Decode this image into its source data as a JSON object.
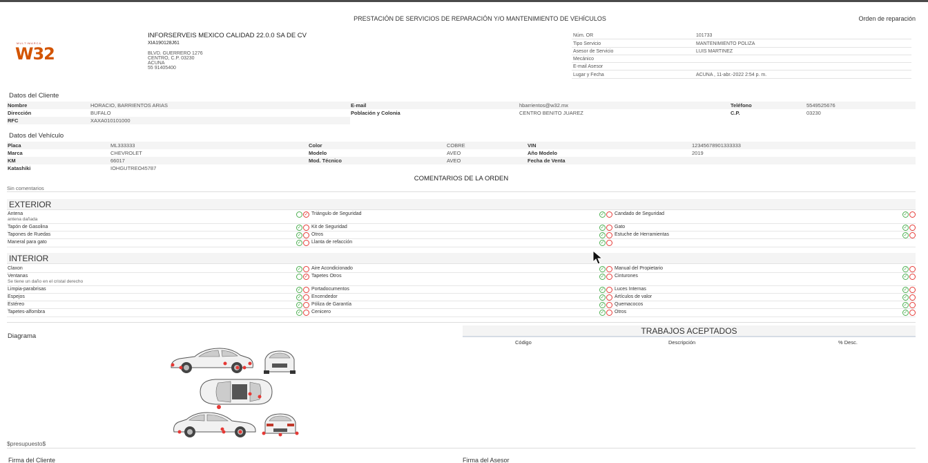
{
  "header": {
    "title": "PRESTACIÓN DE SERVICIOS DE REPARACIÓN Y/O MANTENIMIENTO DE VEHÍCULOS",
    "doc_type": "Orden de reparación",
    "logo_small": "MULTIMARCA",
    "logo_big": "W32"
  },
  "company": {
    "name": "INFORSERVEIS MEXICO CALIDAD 22.0.0 SA DE CV",
    "rfc": "XIA190128J61",
    "addr1": "BLVD. GUERRERO 1276",
    "addr2": "CENTRO, C.P. 03230",
    "addr3": "ACUNA",
    "addr4": "55 91405400"
  },
  "order": [
    {
      "k": "Núm. OR",
      "v": "101733"
    },
    {
      "k": "Tipo Servicio",
      "v": "MANTENIMIENTO POLIZA"
    },
    {
      "k": "Asesor de Servicio",
      "v": "LUIS MARTINEZ"
    },
    {
      "k": "Mecánico",
      "v": ""
    },
    {
      "k": "E-mail Asesor",
      "v": ""
    },
    {
      "k": "Lugar y Fecha",
      "v": "ACUNA , 11-abr.-2022 2:54 p. m."
    }
  ],
  "client": {
    "section": "Datos del Cliente",
    "name_lbl": "Nombre",
    "name": "HORACIO, BARRIENTOS ARIAS",
    "email_lbl": "E-mail",
    "email": "hbarrientos@w32.mx",
    "phone_lbl": "Teléfono",
    "phone": "5549525676",
    "addr_lbl": "Dirección",
    "addr": "BUFALO",
    "city_lbl": "Población y Colonia",
    "city": "CENTRO BENITO JUAREZ",
    "cp_lbl": "C.P.",
    "cp": "03230",
    "rfc_lbl": "RFC",
    "rfc": "XAXA010101000"
  },
  "vehicle": {
    "section": "Datos del Vehículo",
    "plate_lbl": "Placa",
    "plate": "ML333333",
    "color_lbl": "Color",
    "color": "COBRE",
    "vin_lbl": "VIN",
    "vin": "12345678901333333",
    "brand_lbl": "Marca",
    "brand": "CHEVROLET",
    "model_lbl": "Modelo",
    "model": "AVEO",
    "year_lbl": "Año Modelo",
    "year": "2019",
    "km_lbl": "KM",
    "km": "66017",
    "tech_lbl": "Mod. Técnico",
    "tech": "AVEO",
    "sale_lbl": "Fecha de Venta",
    "sale": "",
    "kata_lbl": "Katashiki",
    "kata": "IOHGUTREO45787"
  },
  "comments": {
    "title": "COMENTARIOS DE LA ORDEN",
    "text": "Sin comentarios"
  },
  "exterior": {
    "title": "EXTERIOR",
    "rows": [
      [
        {
          "l": "Antena",
          "n": "antena dañada",
          "s": "bad"
        },
        {
          "l": "Triángulo de Seguridad",
          "n": "",
          "s": "ok"
        },
        {
          "l": "Candado de Seguridad",
          "n": "",
          "s": "ok"
        }
      ],
      [
        {
          "l": "Tapón de Gasolina",
          "n": "",
          "s": "ok"
        },
        {
          "l": "Kit de Seguridad",
          "n": "",
          "s": "ok"
        },
        {
          "l": "Gato",
          "n": "",
          "s": "ok"
        }
      ],
      [
        {
          "l": "Tapones de Ruedas",
          "n": "",
          "s": "ok"
        },
        {
          "l": "Otros",
          "n": "",
          "s": "ok"
        },
        {
          "l": "Estuche de Herramientas",
          "n": "",
          "s": "ok"
        }
      ],
      [
        {
          "l": "Maneral para gato",
          "n": "",
          "s": "ok"
        },
        {
          "l": "Llanta de refacción",
          "n": "",
          "s": "ok"
        }
      ]
    ]
  },
  "interior": {
    "title": "INTERIOR",
    "rows": [
      [
        {
          "l": "Claxon",
          "n": "",
          "s": "ok"
        },
        {
          "l": "Aire Acondicionado",
          "n": "",
          "s": "ok"
        },
        {
          "l": "Manual del Propietario",
          "n": "",
          "s": "ok"
        }
      ],
      [
        {
          "l": "Ventanas",
          "n": "Se tiene un daño en el cristal derecho",
          "s": "bad"
        },
        {
          "l": "Tapetes Otros",
          "n": "",
          "s": "ok"
        },
        {
          "l": "Cinturones",
          "n": "",
          "s": "ok"
        }
      ],
      [
        {
          "l": "Limpia-parabrisas",
          "n": "",
          "s": "ok"
        },
        {
          "l": "Portadocumentos",
          "n": "",
          "s": "ok"
        },
        {
          "l": "Luces Internas",
          "n": "",
          "s": "ok"
        }
      ],
      [
        {
          "l": "Espejos",
          "n": "",
          "s": "ok"
        },
        {
          "l": "Encendedor",
          "n": "",
          "s": "ok"
        },
        {
          "l": "Artículos de valor",
          "n": "",
          "s": "ok"
        }
      ],
      [
        {
          "l": "Estéreo",
          "n": "",
          "s": "ok"
        },
        {
          "l": "Póliza de Garantía",
          "n": "",
          "s": "ok"
        },
        {
          "l": "Quemacocos",
          "n": "",
          "s": "ok"
        }
      ],
      [
        {
          "l": "Tapetes-alfombra",
          "n": "",
          "s": "ok"
        },
        {
          "l": "Cenicero",
          "n": "",
          "s": "ok"
        },
        {
          "l": "Otros",
          "n": "",
          "s": "ok"
        }
      ]
    ]
  },
  "diagram": {
    "title": "Diagrama"
  },
  "works": {
    "title": "TRABAJOS ACEPTADOS",
    "cols": [
      "Código",
      "Descripción",
      "% Desc."
    ]
  },
  "budget": "$presupuesto$",
  "signatures": {
    "client": "Firma del Cliente",
    "advisor": "Firma del Asesor"
  },
  "colors": {
    "ok": "#4caf50",
    "bad": "#e53935",
    "logo": "#d35400"
  }
}
